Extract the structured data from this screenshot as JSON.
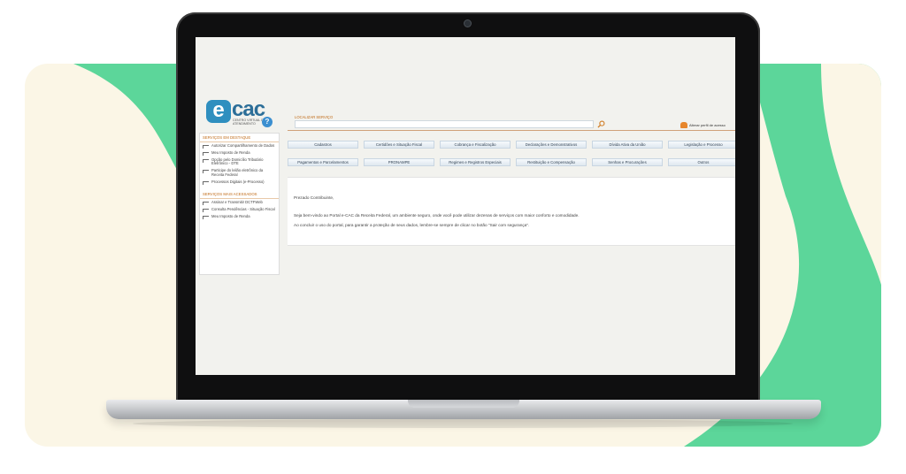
{
  "colors": {
    "green": "#5cd69a",
    "cream": "#fbf6e6",
    "accent_orange": "#c06a16",
    "brand_blue": "#2c6e98"
  },
  "logo": {
    "letter": "e",
    "name": "cac",
    "subtitle": "CENTRO VIRTUAL DE ATENDIMENTO"
  },
  "search": {
    "label": "LOCALIZAR SERVIÇO",
    "value": "",
    "icon": "search-icon"
  },
  "profile": {
    "label": "Alterar perfil de acesso",
    "icon": "user-group-icon"
  },
  "help": {
    "symbol": "?",
    "icon": "help-icon"
  },
  "sidebar": {
    "highlight_title": "SERVIÇOS EM DESTAQUE",
    "highlight_items": [
      "Autorizar Compartilhamento de Dados",
      "Meu Imposto de Renda",
      "Opção pelo Domicílio Tributário Eletrônico - DTE",
      "Participe do leilão eletrônico da Receita Federal",
      "Processos Digitais (e-Processo)"
    ],
    "accessed_title": "SERVIÇOS MAIS ACESSADOS",
    "accessed_items": [
      "Assinar e Transmitir DCTFWeb",
      "Consulta Pendências - Situação Fiscal",
      "Meu Imposto de Renda"
    ]
  },
  "services": {
    "row1": [
      "Cadastros",
      "Certidões e Situação Fiscal",
      "Cobrança e Fiscalização",
      "Declarações e Demonstrativos",
      "Dívida Ativa da União",
      "Legislação e Processo"
    ],
    "row2": [
      "Pagamentos e Parcelamentos",
      "PRONAMPE",
      "Regimes e Registros Especiais",
      "Restituição e Compensação",
      "Senhas e Procurações",
      "Outros"
    ]
  },
  "message": {
    "greeting": "Prezado Contribuinte,",
    "line1": "Seja bem-vindo ao Portal e-CAC da Receita Federal, um ambiente seguro, onde você pode utilizar dezenas de serviços com maior conforto e comodidade.",
    "line2": "Ao concluir o uso do portal, para garantir a proteção de seus dados, lembre-se sempre de clicar no botão \"Sair com segurança\"."
  }
}
